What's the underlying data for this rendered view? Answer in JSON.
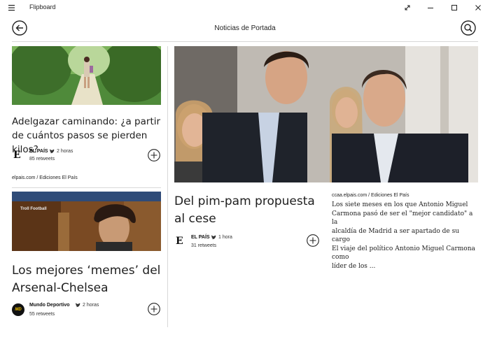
{
  "window": {
    "title": "Flipboard",
    "page_title": "Noticias de Portada"
  },
  "cards": {
    "card1": {
      "headline": "Adelgazar caminando: ¿a partir de cuántos pasos se pierden kilos?",
      "source_name": "EL PAÍS",
      "time": "2 horas",
      "retweets": "85 retweets"
    },
    "caption_between": "elpais.com / Ediciones El País",
    "card2": {
      "image_label": "Troll Football",
      "headline": "Los mejores ‘memes’ del Arsenal-Chelsea",
      "source_name": "Mundo Deportivo",
      "time": "2 horas",
      "retweets": "55 retweets",
      "logo_text": "MD"
    },
    "card3": {
      "headline": "Del pim-pam propuesta al cese",
      "source_name": "EL PAÍS",
      "time": "1 hora",
      "retweets": "31 retweets"
    },
    "card4": {
      "source": "ccaa.elpais.com / Ediciones El País",
      "line1": "Los siete meses en los que Antonio Miguel",
      "line2": "Carmona pasó de ser el \"mejor candidato\" a la",
      "line3": "alcaldía de Madrid a ser apartado de su cargo",
      "line4": "El viaje del político Antonio Miguel Carmona como",
      "line5": "líder de los ..."
    }
  },
  "colors": {
    "accent_dark": "#1e1e1e",
    "divider": "#d8d8d8",
    "twitter_bird": "#333333"
  },
  "icons": {
    "menu": "hamburger-icon",
    "back": "back-arrow-icon",
    "search": "search-icon",
    "add": "plus-circle-icon",
    "twitter": "twitter-bird-icon"
  }
}
